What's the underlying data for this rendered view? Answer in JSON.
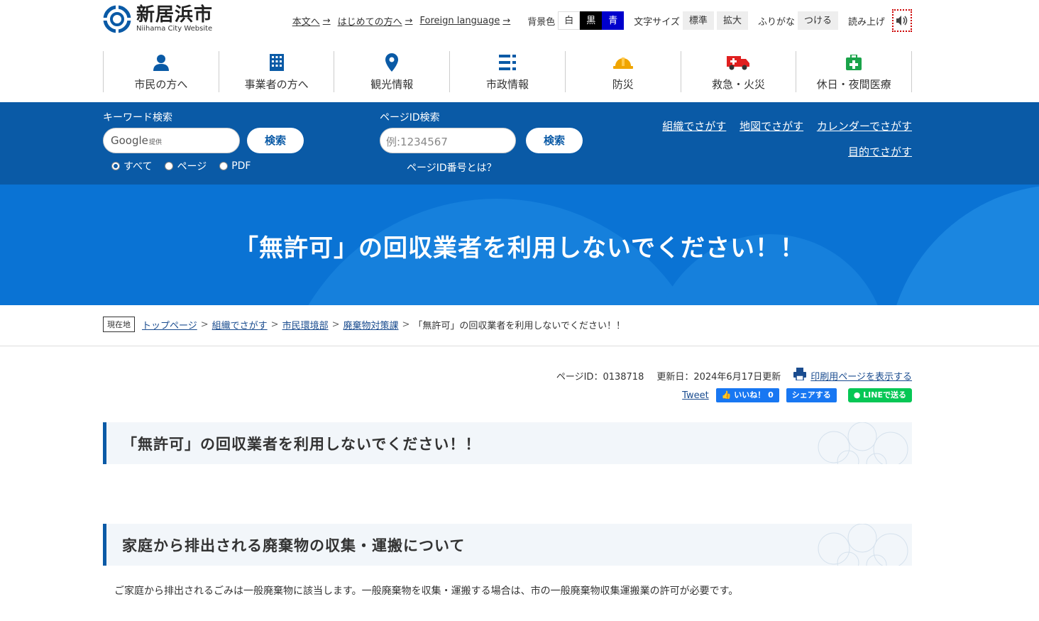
{
  "site": {
    "name": "新居浜市",
    "subtitle": "Niihama City Website"
  },
  "util": {
    "links": [
      "本文へ",
      "はじめての方へ",
      "Foreign language"
    ],
    "bg_label": "背景色",
    "bg_white": "白",
    "bg_black": "黒",
    "bg_blue": "青",
    "font_label": "文字サイズ",
    "font_std": "標準",
    "font_large": "拡大",
    "furigana_label": "ふりがな",
    "furigana_btn": "つける",
    "read_label": "読み上げ"
  },
  "gnav": [
    {
      "label": "市民の方へ",
      "icon": "person-icon"
    },
    {
      "label": "事業者の方へ",
      "icon": "building-icon"
    },
    {
      "label": "観光情報",
      "icon": "map-pin-icon"
    },
    {
      "label": "市政情報",
      "icon": "list-icon"
    },
    {
      "label": "防災",
      "icon": "helmet-icon"
    },
    {
      "label": "救急・火災",
      "icon": "ambulance-icon"
    },
    {
      "label": "休日・夜間医療",
      "icon": "medical-kit-icon"
    }
  ],
  "search": {
    "keyword_title": "キーワード検索",
    "google_label": "Google",
    "google_sub": "提供",
    "search_btn": "検索",
    "radios": [
      "すべて",
      "ページ",
      "PDF"
    ],
    "pageid_title": "ページID検索",
    "pageid_placeholder": "例:1234567",
    "pageid_btn": "検索",
    "pageid_help": "ページID番号とは？",
    "links": [
      "組織でさがす",
      "地図でさがす",
      "カレンダーでさがす",
      "目的でさがす"
    ]
  },
  "page_title": "「無許可」の回収業者を利用しないでください！！",
  "breadcrumb": {
    "here": "現在地",
    "items": [
      "トップページ",
      "組織でさがす",
      "市民環境部",
      "廃棄物対策課"
    ],
    "current": "「無許可」の回収業者を利用しないでください！！"
  },
  "meta": {
    "page_id": "ページID：0138718",
    "updated": "更新日：2024年6月17日更新",
    "print": "印刷用ページを表示する",
    "tweet": "Tweet",
    "like": "いいね！ 0",
    "share": "シェアする",
    "line": "LINEで送る"
  },
  "content": {
    "h2_1": "「無許可」の回収業者を利用しないでください！！",
    "h2_2": "家庭から排出される廃棄物の収集・運搬について",
    "p1": "ご家庭から排出されるごみは一般廃棄物に該当します。一般廃棄物を収集・運搬する場合は、市の一般廃棄物収集運搬業の許可が必要です。"
  },
  "colors": {
    "brand": "#0a5aa6",
    "title_band": "#0a73d4",
    "nav_icon": "#0a5aa6",
    "helmet": "#f0a500",
    "ambulance": "#e02020",
    "medical": "#1aa34a"
  }
}
